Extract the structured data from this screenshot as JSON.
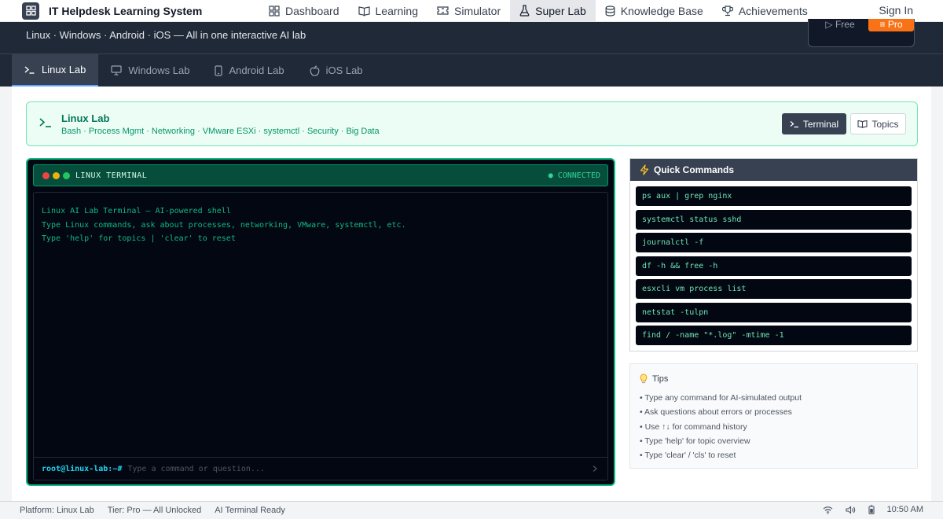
{
  "app": {
    "title": "IT Helpdesk Learning System",
    "sign_in": "Sign In",
    "nav": [
      {
        "label": "Dashboard",
        "icon": "grid-icon"
      },
      {
        "label": "Learning",
        "icon": "book-icon"
      },
      {
        "label": "Simulator",
        "icon": "ticket-icon"
      },
      {
        "label": "Super Lab",
        "icon": "flask-icon",
        "active": true
      },
      {
        "label": "Knowledge Base",
        "icon": "database-icon"
      },
      {
        "label": "Achievements",
        "icon": "trophy-icon"
      }
    ]
  },
  "hero": {
    "subtitle": "Linux · Windows · Android · iOS — All in one interactive AI lab",
    "plan_free": "▷ Free",
    "plan_pro": "≡ Pro"
  },
  "lab_tabs": [
    {
      "label": "Linux Lab",
      "icon": "terminal-icon",
      "active": true
    },
    {
      "label": "Windows Lab",
      "icon": "monitor-icon"
    },
    {
      "label": "Android Lab",
      "icon": "smartphone-icon"
    },
    {
      "label": "iOS Lab",
      "icon": "apple-icon"
    }
  ],
  "banner": {
    "title": "Linux Lab",
    "topics": "Bash · Process Mgmt · Networking · VMware ESXi · systemctl · Security · Big Data",
    "terminal_button": "Terminal",
    "topics_button": "Topics"
  },
  "terminal": {
    "title": "LINUX TERMINAL",
    "status": "● CONNECTED",
    "lines": [
      "Linux AI Lab Terminal — AI-powered shell",
      "Type Linux commands, ask about processes, networking, VMware, systemctl, etc.",
      "Type 'help' for topics | 'clear' to reset"
    ],
    "prompt": "root@linux-lab:~#",
    "placeholder": "Type a command or question..."
  },
  "quick_commands": {
    "title": "Quick Commands",
    "items": [
      "ps aux | grep nginx",
      "systemctl status sshd",
      "journalctl -f",
      "df -h && free -h",
      "esxcli vm process list",
      "netstat -tulpn",
      "find / -name \"*.log\" -mtime -1"
    ]
  },
  "tips": {
    "title": "Tips",
    "items": [
      "• Type any command for AI-simulated output",
      "• Ask questions about errors or processes",
      "• Use ↑↓ for command history",
      "• Type 'help' for topic overview",
      "• Type 'clear' / 'cls' to reset"
    ]
  },
  "statusbar": {
    "platform": "Platform: Linux Lab",
    "tier": "Tier: Pro — All Unlocked",
    "ai_status": "AI Terminal Ready",
    "time": "10:50 AM"
  },
  "colors": {
    "accent_green": "#10b981",
    "dark_bg": "#1f2937",
    "pro_orange": "#f97316",
    "prompt_cyan": "#22d3ee"
  }
}
